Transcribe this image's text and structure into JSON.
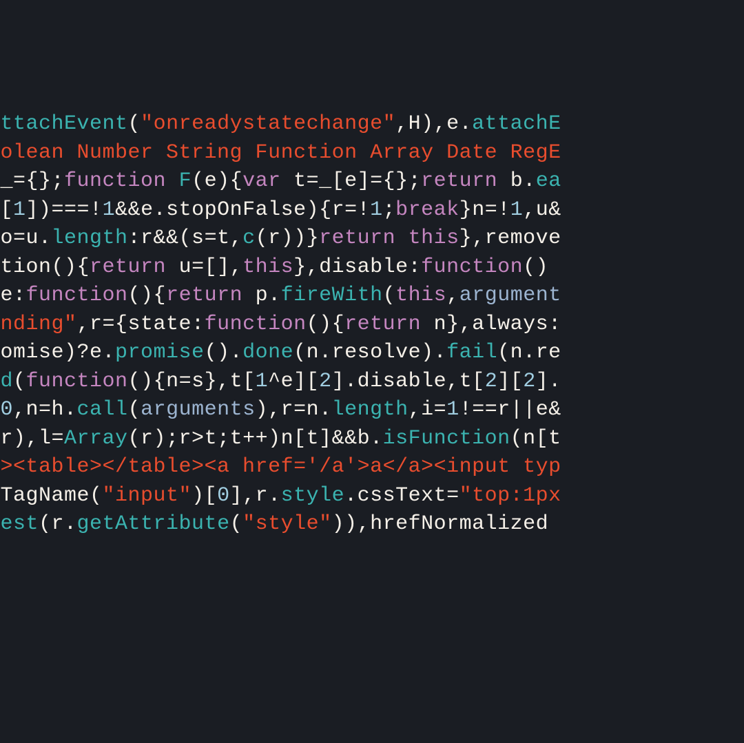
{
  "code": {
    "lines": [
      [
        {
          "c": "t",
          "t": "attachEvent"
        },
        {
          "c": "w",
          "t": "("
        },
        {
          "c": "r",
          "t": "\"onreadystatechange\""
        },
        {
          "c": "w",
          "t": ",H),e."
        },
        {
          "c": "t",
          "t": "attachE"
        }
      ],
      [
        {
          "c": "r",
          "t": "oolean Number String Function Array Date RegE"
        }
      ],
      [
        {
          "c": "w",
          "t": " _={};"
        },
        {
          "c": "p",
          "t": "function"
        },
        {
          "c": "w",
          "t": " "
        },
        {
          "c": "t",
          "t": "F"
        },
        {
          "c": "w",
          "t": "(e){"
        },
        {
          "c": "p",
          "t": "var"
        },
        {
          "c": "w",
          "t": " t=_[e]={};"
        },
        {
          "c": "p",
          "t": "return"
        },
        {
          "c": "w",
          "t": " b."
        },
        {
          "c": "t",
          "t": "ea"
        }
      ],
      [
        {
          "c": "w",
          "t": "t["
        },
        {
          "c": "lb",
          "t": "1"
        },
        {
          "c": "w",
          "t": "])===!"
        },
        {
          "c": "lb",
          "t": "1"
        },
        {
          "c": "w",
          "t": "&&e.stopOnFalse){r=!"
        },
        {
          "c": "lb",
          "t": "1"
        },
        {
          "c": "w",
          "t": ";"
        },
        {
          "c": "p",
          "t": "break"
        },
        {
          "c": "w",
          "t": "}n=!"
        },
        {
          "c": "lb",
          "t": "1"
        },
        {
          "c": "w",
          "t": ",u&"
        }
      ],
      [
        {
          "c": "w",
          "t": "?o=u."
        },
        {
          "c": "t",
          "t": "length"
        },
        {
          "c": "w",
          "t": ":r&&(s=t,"
        },
        {
          "c": "t",
          "t": "c"
        },
        {
          "c": "w",
          "t": "(r))}"
        },
        {
          "c": "p",
          "t": "return this"
        },
        {
          "c": "w",
          "t": "},remove"
        }
      ],
      [
        {
          "c": "w",
          "t": "ction(){"
        },
        {
          "c": "p",
          "t": "return"
        },
        {
          "c": "w",
          "t": " u=[],"
        },
        {
          "c": "p",
          "t": "this"
        },
        {
          "c": "w",
          "t": "},disable:"
        },
        {
          "c": "p",
          "t": "function"
        },
        {
          "c": "w",
          "t": "()"
        }
      ],
      [
        {
          "c": "w",
          "t": "re:"
        },
        {
          "c": "p",
          "t": "function"
        },
        {
          "c": "w",
          "t": "(){"
        },
        {
          "c": "p",
          "t": "return"
        },
        {
          "c": "w",
          "t": " p."
        },
        {
          "c": "t",
          "t": "fireWith"
        },
        {
          "c": "w",
          "t": "("
        },
        {
          "c": "p",
          "t": "this"
        },
        {
          "c": "w",
          "t": ","
        },
        {
          "c": "b",
          "t": "argument"
        }
      ],
      [
        {
          "c": "r",
          "t": "ending\""
        },
        {
          "c": "w",
          "t": ",r={state:"
        },
        {
          "c": "p",
          "t": "function"
        },
        {
          "c": "w",
          "t": "(){"
        },
        {
          "c": "p",
          "t": "return"
        },
        {
          "c": "w",
          "t": " n},always:"
        }
      ],
      [
        {
          "c": "w",
          "t": "romise)?e."
        },
        {
          "c": "t",
          "t": "promise"
        },
        {
          "c": "w",
          "t": "()."
        },
        {
          "c": "t",
          "t": "done"
        },
        {
          "c": "w",
          "t": "(n.resolve)."
        },
        {
          "c": "t",
          "t": "fail"
        },
        {
          "c": "w",
          "t": "(n.re"
        }
      ],
      [
        {
          "c": "t",
          "t": "dd"
        },
        {
          "c": "w",
          "t": "("
        },
        {
          "c": "p",
          "t": "function"
        },
        {
          "c": "w",
          "t": "(){n=s},t["
        },
        {
          "c": "lb",
          "t": "1"
        },
        {
          "c": "w",
          "t": "^e]["
        },
        {
          "c": "lb",
          "t": "2"
        },
        {
          "c": "w",
          "t": "].disable,t["
        },
        {
          "c": "lb",
          "t": "2"
        },
        {
          "c": "w",
          "t": "]["
        },
        {
          "c": "lb",
          "t": "2"
        },
        {
          "c": "w",
          "t": "]."
        }
      ],
      [
        {
          "c": "w",
          "t": "="
        },
        {
          "c": "lb",
          "t": "0"
        },
        {
          "c": "w",
          "t": ",n=h."
        },
        {
          "c": "t",
          "t": "call"
        },
        {
          "c": "w",
          "t": "("
        },
        {
          "c": "b",
          "t": "arguments"
        },
        {
          "c": "w",
          "t": "),r=n."
        },
        {
          "c": "t",
          "t": "length"
        },
        {
          "c": "w",
          "t": ",i="
        },
        {
          "c": "lb",
          "t": "1"
        },
        {
          "c": "w",
          "t": "!==r||e&"
        }
      ],
      [
        {
          "c": "w",
          "t": "(r),l="
        },
        {
          "c": "t",
          "t": "Array"
        },
        {
          "c": "w",
          "t": "(r);r>t;t++)n[t]&&b."
        },
        {
          "c": "t",
          "t": "isFunction"
        },
        {
          "c": "w",
          "t": "(n[t"
        }
      ],
      [
        {
          "c": "r",
          "t": "/><table></table><a href='/a'>a</a><input typ"
        }
      ],
      [
        {
          "c": "w",
          "t": "yTagName("
        },
        {
          "c": "r",
          "t": "\"input\""
        },
        {
          "c": "w",
          "t": ")["
        },
        {
          "c": "lb",
          "t": "0"
        },
        {
          "c": "w",
          "t": "],r."
        },
        {
          "c": "t",
          "t": "style"
        },
        {
          "c": "w",
          "t": ".cssText="
        },
        {
          "c": "r",
          "t": "\"top:1px"
        }
      ],
      [
        {
          "c": "t",
          "t": "test"
        },
        {
          "c": "w",
          "t": "(r."
        },
        {
          "c": "t",
          "t": "getAttribute"
        },
        {
          "c": "w",
          "t": "("
        },
        {
          "c": "r",
          "t": "\"style\""
        },
        {
          "c": "w",
          "t": ")),hrefNormalized"
        }
      ],
      [
        {
          "c": "w",
          "t": " "
        }
      ],
      [
        {
          "c": "w",
          "t": " "
        }
      ]
    ]
  }
}
